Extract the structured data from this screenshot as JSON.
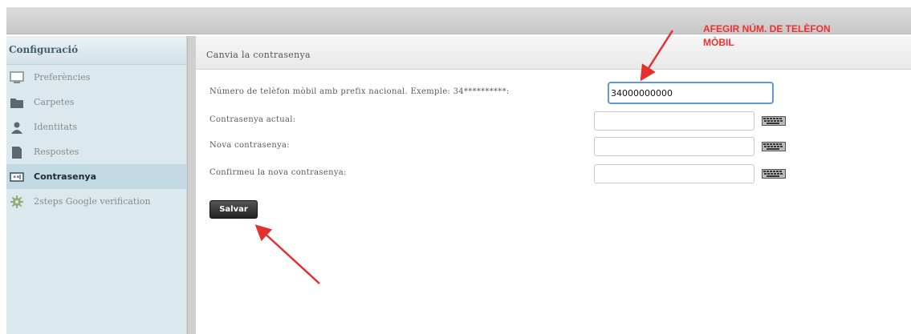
{
  "sidebar": {
    "title": "Configuració",
    "items": [
      {
        "label": "Preferències",
        "icon": "monitor-icon",
        "active": false
      },
      {
        "label": "Carpetes",
        "icon": "folder-icon",
        "active": false
      },
      {
        "label": "Identitats",
        "icon": "user-icon",
        "active": false
      },
      {
        "label": "Respostes",
        "icon": "document-icon",
        "active": false
      },
      {
        "label": "Contrasenya",
        "icon": "password-field-icon",
        "active": true
      },
      {
        "label": "2steps Google verification",
        "icon": "gear-icon",
        "active": false
      }
    ]
  },
  "content": {
    "title": "Canvia la contrasenya",
    "fields": [
      {
        "label": "Número de telèfon mòbil amb prefix nacional. Exemple: 34**********:",
        "value": "34000000000"
      },
      {
        "label": "Contrasenya actual:",
        "value": ""
      },
      {
        "label": "Nova contrasenya:",
        "value": ""
      },
      {
        "label": "Confirmeu la nova contrasenya:",
        "value": ""
      }
    ],
    "save_label": "Salvar"
  },
  "annotation": {
    "line1": "AFEGIR NÚM. DE TELÈFON",
    "line2": "MÒBIL",
    "color": "#ee3030"
  },
  "colors": {
    "sidebar_bg": "#dbe8ee",
    "sidebar_active": "#c3d9e4",
    "focus_border": "#5f9ad3"
  }
}
